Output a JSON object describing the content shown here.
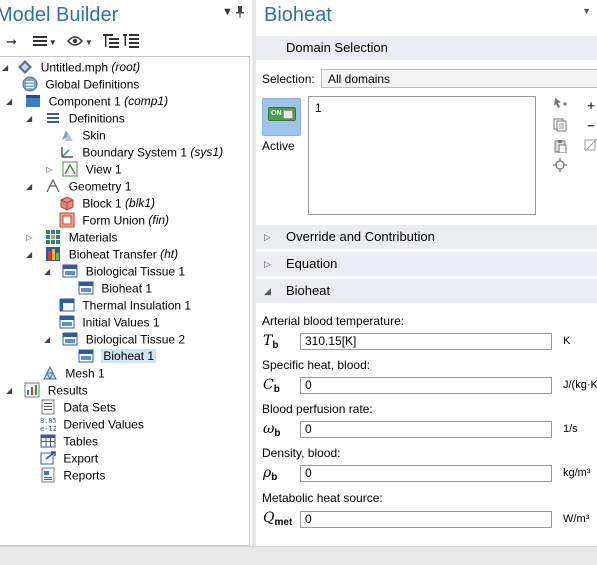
{
  "model_builder": {
    "title": "Model Builder",
    "tree": [
      {
        "label": "Untitled.mph",
        "tag": "(root)",
        "icon": "mph-file-icon"
      },
      {
        "label": "Global Definitions",
        "tag": "",
        "icon": "global-definitions-icon"
      },
      {
        "label": "Component 1",
        "tag": "(comp1)",
        "icon": "component-icon"
      },
      {
        "label": "Definitions",
        "tag": "",
        "icon": "definitions-icon"
      },
      {
        "label": "Skin",
        "tag": "",
        "icon": "skin-icon"
      },
      {
        "label": "Boundary System 1",
        "tag": "(sys1)",
        "icon": "coordinate-system-icon"
      },
      {
        "label": "View 1",
        "tag": "",
        "icon": "view-icon"
      },
      {
        "label": "Geometry 1",
        "tag": "",
        "icon": "geometry-icon"
      },
      {
        "label": "Block 1",
        "tag": "(blk1)",
        "icon": "block-icon"
      },
      {
        "label": "Form Union",
        "tag": "(fin)",
        "icon": "form-union-icon"
      },
      {
        "label": "Materials",
        "tag": "",
        "icon": "materials-icon"
      },
      {
        "label": "Bioheat Transfer",
        "tag": "(ht)",
        "icon": "bioheat-transfer-icon"
      },
      {
        "label": "Biological Tissue 1",
        "tag": "",
        "icon": "domain-node-icon"
      },
      {
        "label": "Bioheat 1",
        "tag": "",
        "icon": "domain-node-icon"
      },
      {
        "label": "Thermal Insulation 1",
        "tag": "",
        "icon": "boundary-node-icon"
      },
      {
        "label": "Initial Values 1",
        "tag": "",
        "icon": "domain-node-icon"
      },
      {
        "label": "Biological Tissue 2",
        "tag": "",
        "icon": "domain-node-icon"
      },
      {
        "label": "Bioheat 1",
        "tag": "",
        "icon": "domain-node-icon"
      },
      {
        "label": "Mesh 1",
        "tag": "",
        "icon": "mesh-icon"
      },
      {
        "label": "Results",
        "tag": "",
        "icon": "results-icon"
      },
      {
        "label": "Data Sets",
        "tag": "",
        "icon": "data-sets-icon"
      },
      {
        "label": "Derived Values",
        "tag": "",
        "icon": "derived-values-icon"
      },
      {
        "label": "Tables",
        "tag": "",
        "icon": "tables-icon"
      },
      {
        "label": "Export",
        "tag": "",
        "icon": "export-icon"
      },
      {
        "label": "Reports",
        "tag": "",
        "icon": "reports-icon"
      }
    ]
  },
  "settings": {
    "title": "Bioheat",
    "domain_selection": {
      "header": "Domain Selection",
      "selection_label": "Selection:",
      "selection_value": "All domains",
      "active_toggle_text": "ON",
      "active_label": "Active",
      "list_items": [
        "1"
      ]
    },
    "collapsed_sections": [
      "Override and Contribution",
      "Equation"
    ],
    "bioheat_section": {
      "header": "Bioheat",
      "properties": [
        {
          "label": "Arterial blood temperature:",
          "symbol": "T",
          "subscript": "b",
          "value": "310.15[K]",
          "unit": "K"
        },
        {
          "label": "Specific heat, blood:",
          "symbol": "C",
          "subscript": "b",
          "value": "0",
          "unit": "J/(kg·K"
        },
        {
          "label": "Blood perfusion rate:",
          "symbol": "ω",
          "subscript": "b",
          "value": "0",
          "unit": "1/s"
        },
        {
          "label": "Density, blood:",
          "symbol": "ρ",
          "subscript": "b",
          "value": "0",
          "unit": "kg/m³"
        },
        {
          "label": "Metabolic heat source:",
          "symbol": "Q",
          "subscript": "met",
          "value": "0",
          "unit": "W/m³"
        }
      ]
    }
  },
  "colors": {
    "title_blue": "#2f6fb0",
    "section_header": "#eaeef4",
    "selected_row": "#cfe3f7",
    "active_on": "#4aa14a"
  }
}
